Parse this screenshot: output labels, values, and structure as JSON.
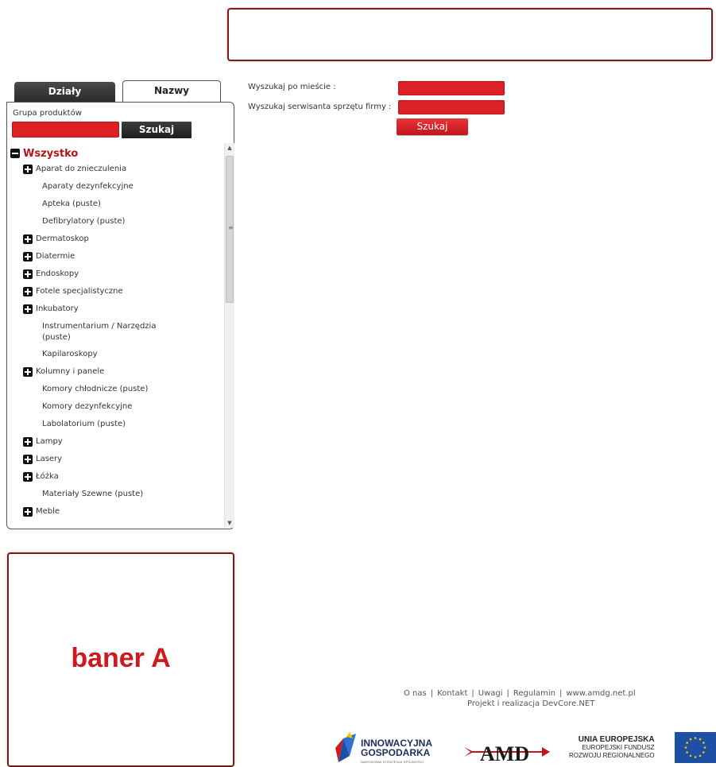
{
  "tabs": {
    "dzialy": "Działy",
    "nazwy": "Nazwy"
  },
  "panel": {
    "group_label": "Grupa produktów",
    "search_button": "Szukaj"
  },
  "tree": {
    "root": "Wszystko",
    "items": [
      {
        "label": "Aparat do znieczulenia",
        "expandable": true
      },
      {
        "label": "Aparaty dezynfekcyjne",
        "expandable": false
      },
      {
        "label": "Apteka (puste)",
        "expandable": false
      },
      {
        "label": "Defibrylatory (puste)",
        "expandable": false
      },
      {
        "label": "Dermatoskop",
        "expandable": true
      },
      {
        "label": "Diatermie",
        "expandable": true
      },
      {
        "label": "Endoskopy",
        "expandable": true
      },
      {
        "label": "Fotele specjalistyczne",
        "expandable": true
      },
      {
        "label": "Inkubatory",
        "expandable": true
      },
      {
        "label": "Instrumentarium / Narzędzia (puste)",
        "expandable": false
      },
      {
        "label": "Kapilaroskopy",
        "expandable": false
      },
      {
        "label": "Kolumny i panele",
        "expandable": true
      },
      {
        "label": "Komory chłodnicze (puste)",
        "expandable": false
      },
      {
        "label": "Komory dezynfekcyjne",
        "expandable": false
      },
      {
        "label": "Labolatorium (puste)",
        "expandable": false
      },
      {
        "label": "Lampy",
        "expandable": true
      },
      {
        "label": "Lasery",
        "expandable": true
      },
      {
        "label": "Łóżka",
        "expandable": true
      },
      {
        "label": "Materiały Szewne (puste)",
        "expandable": false
      },
      {
        "label": "Meble",
        "expandable": true
      }
    ]
  },
  "search": {
    "city_label": "Wyszukaj po mieście :",
    "company_label": "Wyszukaj serwisanta sprzętu firmy :",
    "button": "Szukaj"
  },
  "banner_a": "baner A",
  "footer": {
    "links": [
      "O nas",
      "Kontakt",
      "Uwagi",
      "Regulamin",
      "www.amdg.net.pl"
    ],
    "credit": "Projekt i realizacja DevCore.NET"
  },
  "logos": {
    "ig_line1": "INNOWACYJNA",
    "ig_line2": "GOSPODARKA",
    "ig_small": "NARODOWA STRATEGIA SPÓJNOŚCI",
    "amdg": "AMD",
    "ue_line1": "UNIA EUROPEJSKA",
    "ue_line2": "EUROPEJSKI FUNDUSZ",
    "ue_line3": "ROZWOJU REGIONALNEGO"
  },
  "colors": {
    "accent_red": "#dd1f26",
    "banner_border": "#7a1a1a",
    "tab_dark": "#2a2a2a"
  }
}
